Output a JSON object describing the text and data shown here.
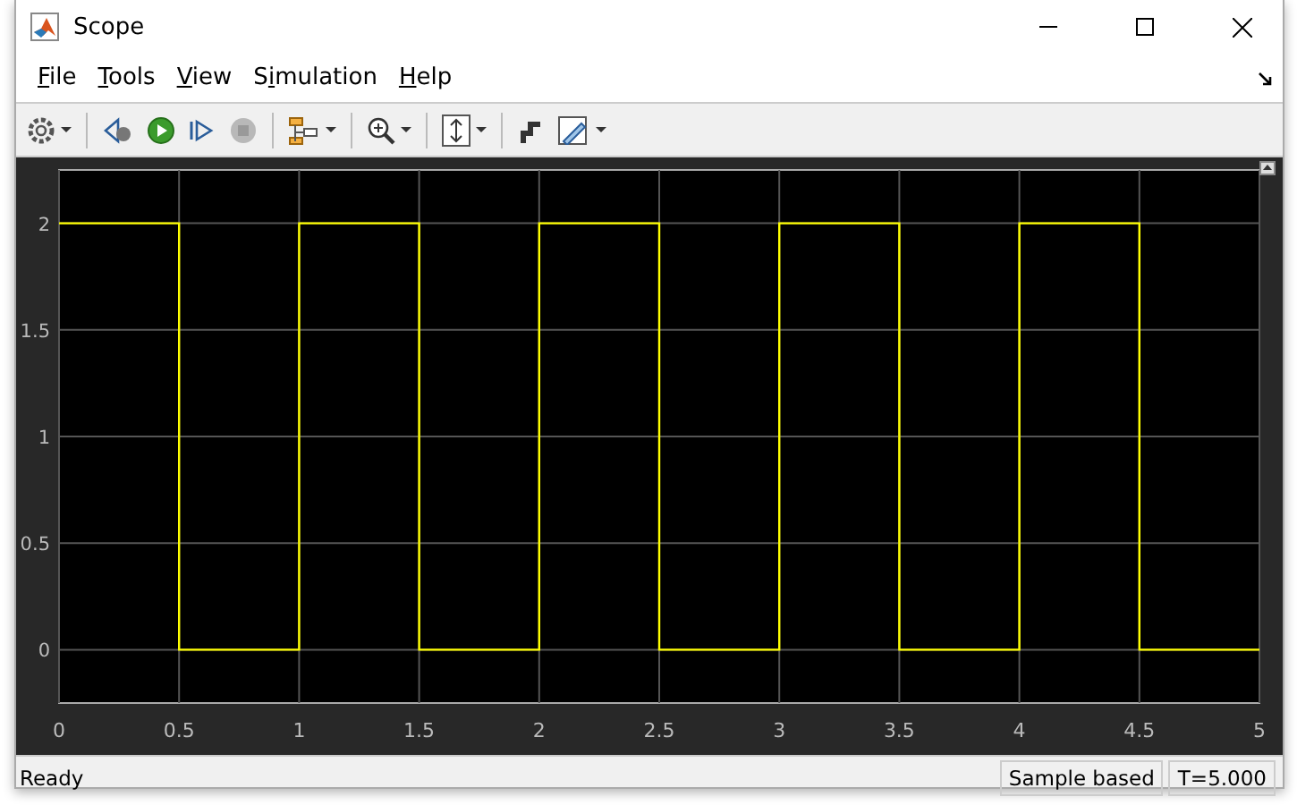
{
  "window": {
    "title": "Scope"
  },
  "menu": [
    {
      "key": "F",
      "post": "ile"
    },
    {
      "key": "T",
      "post": "ools"
    },
    {
      "key": "V",
      "post": "iew"
    },
    {
      "pre": "S",
      "key": "i",
      "post": "mulation"
    },
    {
      "key": "H",
      "post": "elp"
    }
  ],
  "toolbar": {
    "stop_disabled": true
  },
  "plot": {
    "chart_data": {
      "type": "line",
      "xlim": [
        0,
        5
      ],
      "ylim": [
        -0.25,
        2.25
      ],
      "xticks": [
        0,
        0.5,
        1,
        1.5,
        2,
        2.5,
        3,
        3.5,
        4,
        4.5,
        5
      ],
      "yticks": [
        0,
        0.5,
        1,
        1.5,
        2
      ],
      "grid": true,
      "x": [
        0,
        0.5,
        0.5,
        1,
        1,
        1.5,
        1.5,
        2,
        2,
        2.5,
        2.5,
        3,
        3,
        3.5,
        3.5,
        4,
        4,
        4.5,
        4.5,
        5
      ],
      "series": [
        {
          "color": "#ffff00",
          "values": [
            2,
            2,
            0,
            0,
            2,
            2,
            0,
            0,
            2,
            2,
            0,
            0,
            2,
            2,
            0,
            0,
            2,
            2,
            0,
            0
          ]
        }
      ]
    }
  },
  "status_bar": {
    "message": "Ready",
    "mode": "Sample based",
    "time": "T=5.000"
  }
}
